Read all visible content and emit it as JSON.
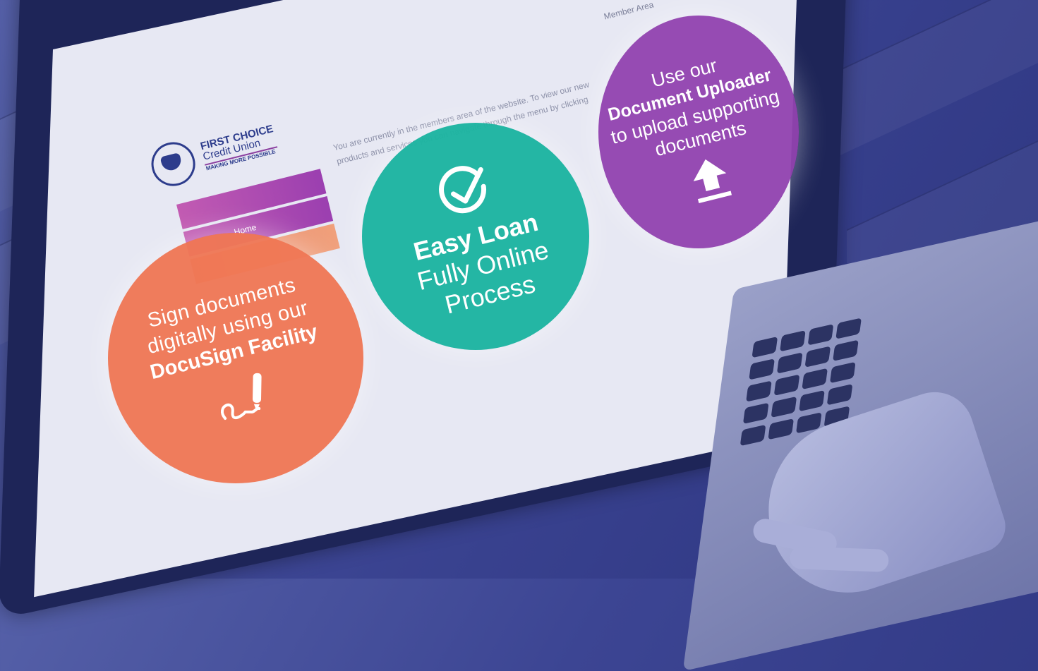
{
  "site": {
    "brand_line1": "FIRST CHOICE",
    "brand_line2": "Credit Union",
    "brand_tagline": "MAKING MORE POSSIBLE",
    "member_area": "Member Area",
    "menu_home": "Home",
    "intro_text": "You are currently in the members area of the website. To view our new products and services you can navigate through the menu by clicking"
  },
  "features": {
    "sign": {
      "line1": "Sign documents",
      "line2": "digitally using our",
      "line3": "DocuSign Facility",
      "icon": "signature-pen-icon",
      "color": "#ef7855"
    },
    "loan": {
      "title": "Easy Loan",
      "line2": "Fully Online",
      "line3": "Process",
      "icon": "checkmark-circle-icon",
      "color": "#1cb4a0"
    },
    "upload": {
      "line1": "Use our",
      "line2": "Document Uploader",
      "line3": "to upload supporting",
      "line4": "documents",
      "icon": "upload-arrow-icon",
      "color": "#9142af"
    }
  }
}
